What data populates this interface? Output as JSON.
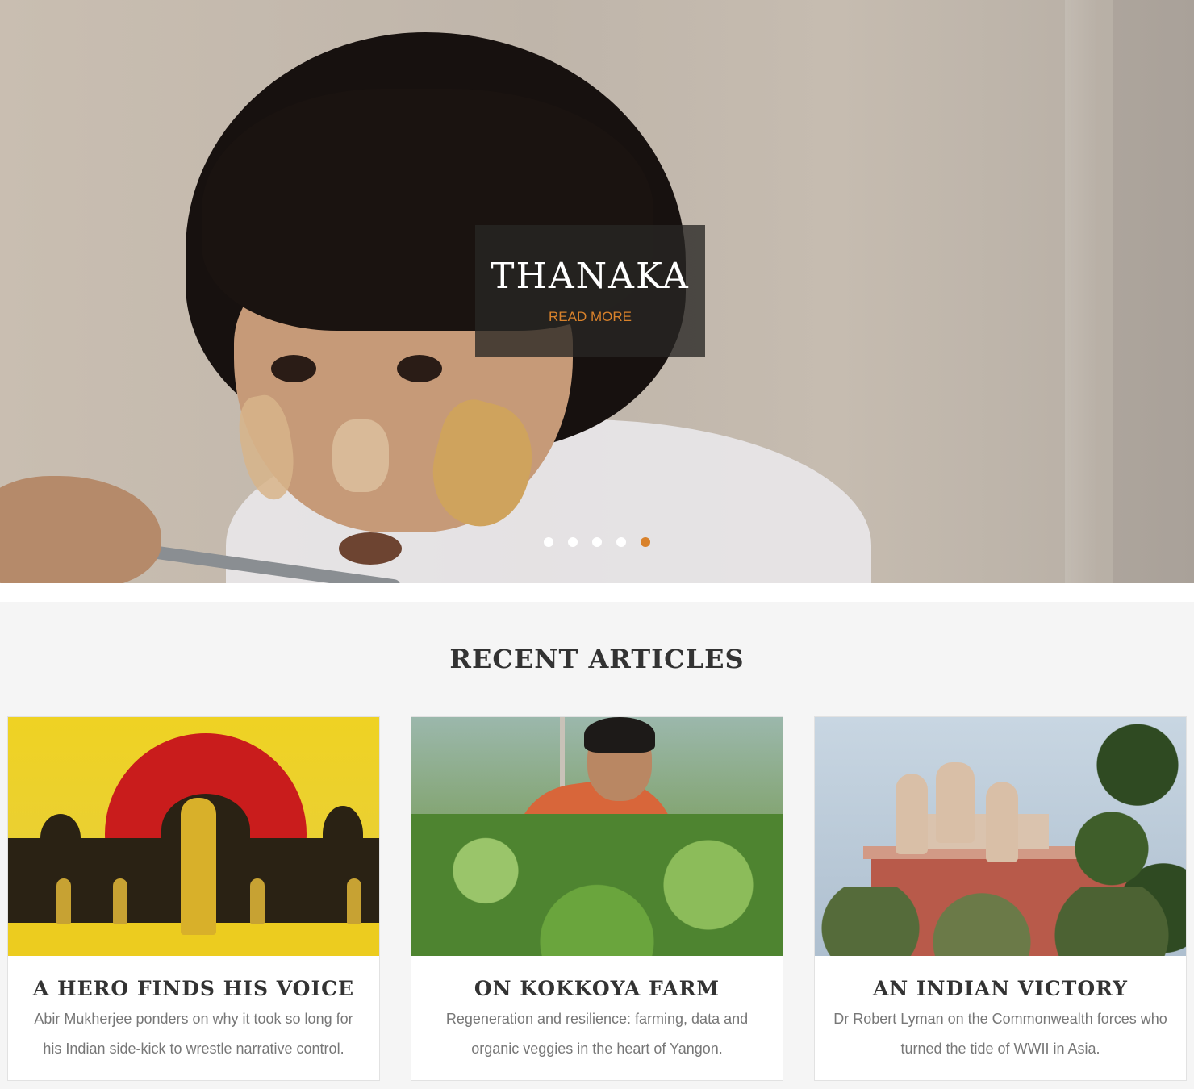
{
  "hero": {
    "title": "THANAKA",
    "read_more": "READ MORE",
    "slides_total": 5,
    "active_slide": 5,
    "accent_color": "#d9822b"
  },
  "recent": {
    "heading": "RECENT ARTICLES",
    "articles": [
      {
        "title": "A HERO FINDS HIS VOICE",
        "description": "Abir Mukherjee ponders on why it took so long for his Indian side-kick to wrestle narrative control."
      },
      {
        "title": "ON KOKKOYA FARM",
        "description": "Regeneration and resilience: farming, data and organic veggies in the heart of Yangon."
      },
      {
        "title": "AN INDIAN VICTORY",
        "description": "Dr Robert Lyman on the Commonwealth forces who turned the tide of WWII in Asia."
      }
    ]
  }
}
